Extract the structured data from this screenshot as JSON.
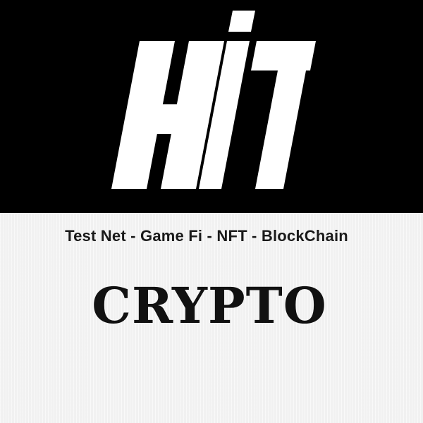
{
  "logo": {
    "text": "HIT",
    "colors": {
      "background": "#000000",
      "foreground": "#ffffff"
    }
  },
  "tagline": "Test Net - Game Fi - NFT - BlockChain",
  "headline": "CRYPTO",
  "colors": {
    "panel_background": "#f1f1f1",
    "text": "#111111"
  }
}
